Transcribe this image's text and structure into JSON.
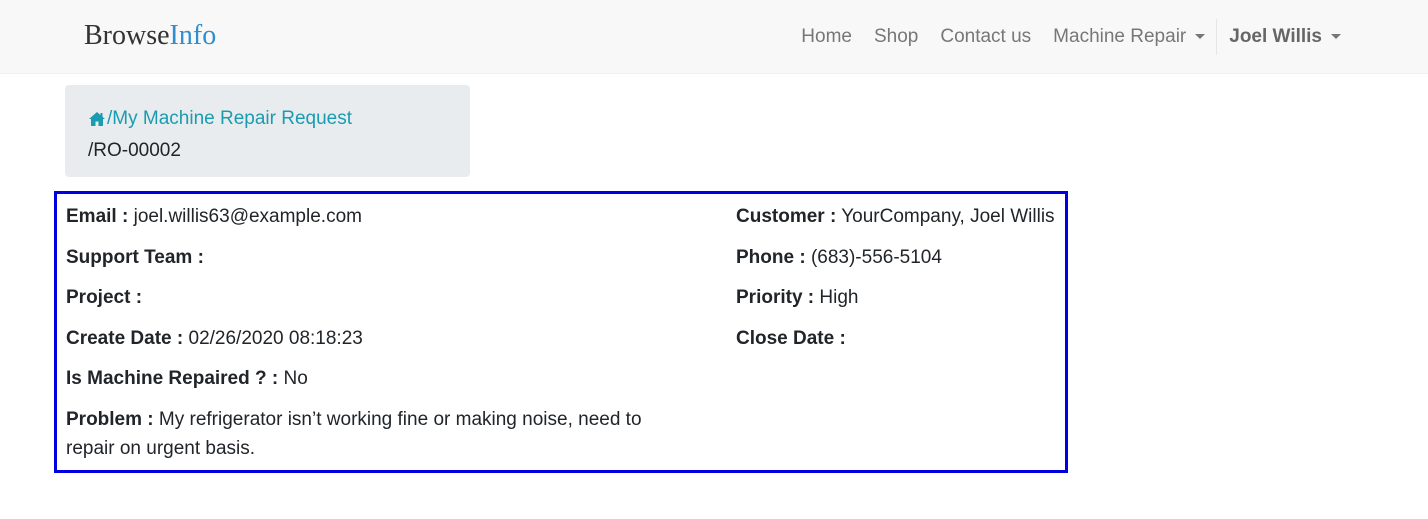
{
  "brand": {
    "part1": "Browse",
    "part2": "Info"
  },
  "nav": {
    "home": "Home",
    "shop": "Shop",
    "contact": "Contact us",
    "machine_repair": "Machine Repair",
    "user": "Joel Willis"
  },
  "breadcrumb": {
    "icon": "home-icon",
    "link_label": "/My Machine Repair Request",
    "current": "/RO-00002"
  },
  "details": {
    "left": [
      {
        "label": "Email :",
        "value": "joel.willis63@example.com"
      },
      {
        "label": "Support Team :",
        "value": ""
      },
      {
        "label": "Project :",
        "value": ""
      },
      {
        "label": "Create Date :",
        "value": "02/26/2020 08:18:23"
      },
      {
        "label": "Is Machine Repaired ? :",
        "value": "No"
      },
      {
        "label": "Problem :",
        "value": "My refrigerator isn’t working fine or making noise, need to repair on urgent basis."
      }
    ],
    "right": [
      {
        "label": "Customer :",
        "value": "YourCompany, Joel Willis"
      },
      {
        "label": "Phone :",
        "value": "(683)-556-5104"
      },
      {
        "label": "Priority :",
        "value": "High"
      },
      {
        "label": "Close Date :",
        "value": ""
      }
    ]
  },
  "colors": {
    "brand_accent": "#2f8ecd",
    "link": "#1a9cb0",
    "highlight_border": "#0000e0",
    "breadcrumb_bg": "#e9ecef"
  }
}
